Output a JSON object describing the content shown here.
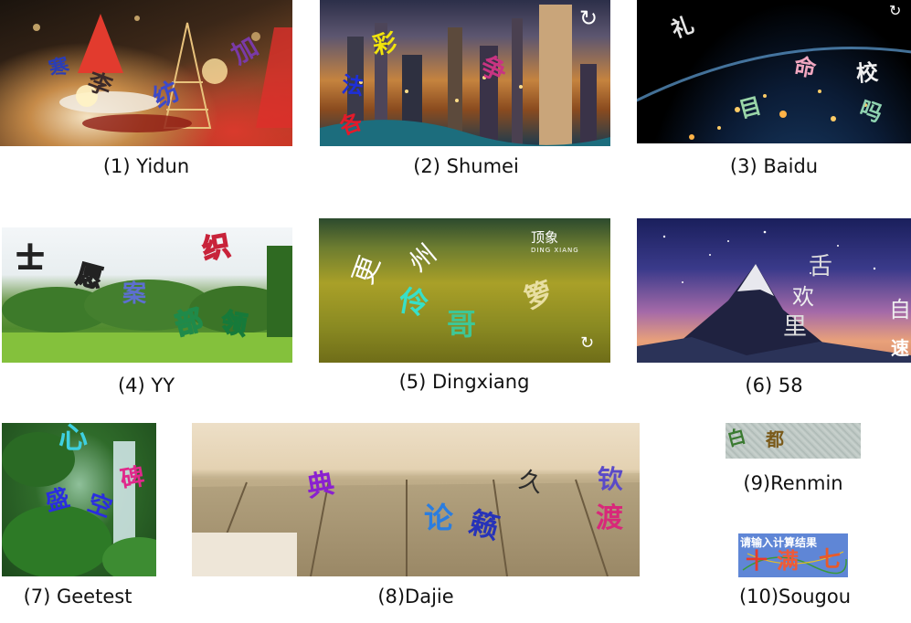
{
  "captcha_panels": [
    {
      "caption": "(1) Yidun",
      "chars": [
        "寒",
        "李",
        "纺",
        "加"
      ]
    },
    {
      "caption": "(2) Shumei",
      "chars": [
        "彩",
        "法",
        "争",
        "各"
      ]
    },
    {
      "caption": "(3) Baidu",
      "chars": [
        "礼",
        "命",
        "校",
        "目",
        "吗"
      ]
    },
    {
      "caption": "(4) YY",
      "chars": [
        "士",
        "愿",
        "案",
        "织",
        "部",
        "领"
      ]
    },
    {
      "caption": "(5) Dingxiang",
      "chars": [
        "更",
        "州",
        "伶",
        "哥",
        "箩"
      ],
      "logo": {
        "main": "顶象",
        "sub": "DING XIANG"
      }
    },
    {
      "caption": "(6) 58",
      "chars": [
        "舌",
        "欢",
        "里",
        "自",
        "速"
      ]
    },
    {
      "caption": "(7) Geetest",
      "chars": [
        "心",
        "碑",
        "盛",
        "空"
      ]
    },
    {
      "caption": "(8)Dajie",
      "chars": [
        "典",
        "久",
        "钦",
        "论",
        "籁",
        "渡"
      ]
    },
    {
      "caption": "(9)Renmin",
      "chars": [
        "白",
        "都"
      ]
    },
    {
      "caption": "(10)Sougou",
      "chars": [
        "十",
        "满",
        "七"
      ],
      "prompt": "请输入计算结果"
    }
  ],
  "icons": {
    "refresh": "refresh-icon",
    "logo": "dingxiang-logo-icon"
  },
  "colors": {
    "caption_text": "#111111",
    "white": "#ffffff"
  }
}
